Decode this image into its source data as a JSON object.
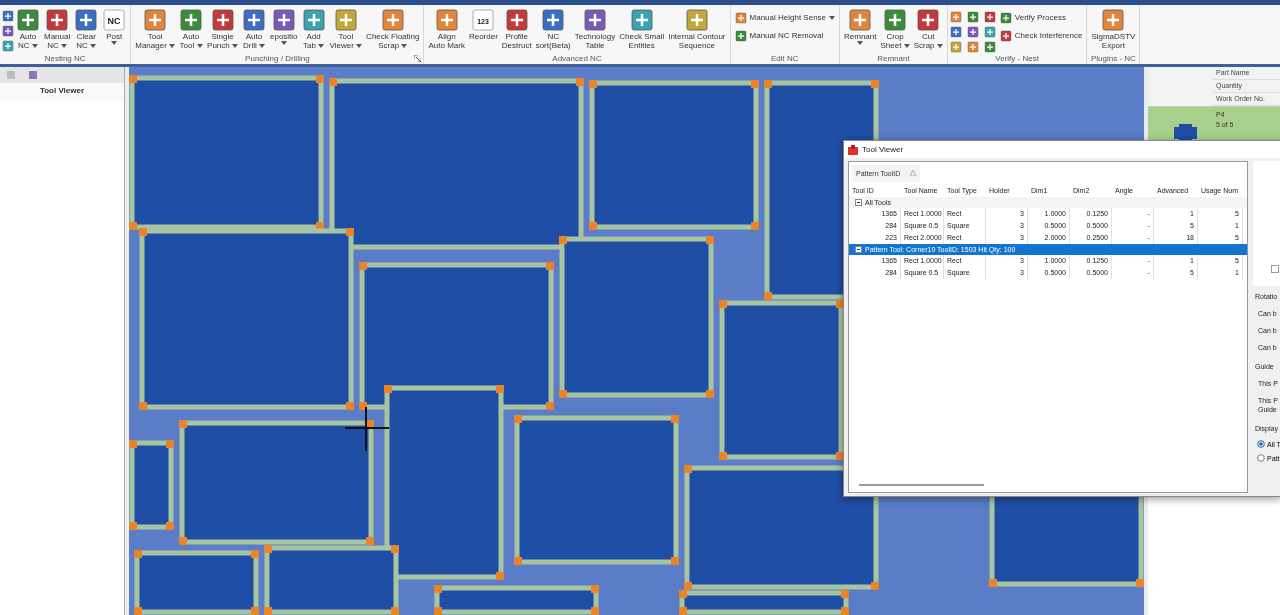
{
  "ribbon": {
    "groups": [
      {
        "label": "Nesting NC",
        "buttons": [
          {
            "kind": "icon-stack"
          },
          {
            "kind": "large",
            "lines": [
              "Auto",
              "NC"
            ],
            "dropdown": true
          },
          {
            "kind": "large",
            "lines": [
              "Manual",
              "NC"
            ],
            "dropdown": true
          },
          {
            "kind": "large",
            "lines": [
              "Clear",
              "NC"
            ],
            "dropdown": true
          },
          {
            "kind": "large",
            "lines": [
              "Post"
            ],
            "dropdown": true,
            "icon_text": "NC"
          }
        ]
      },
      {
        "label": "Punching / Drilling",
        "launcher": true,
        "buttons": [
          {
            "kind": "large",
            "lines": [
              "Tool",
              "Manager"
            ],
            "dropdown": true
          },
          {
            "kind": "large",
            "lines": [
              "Auto",
              "Tool"
            ],
            "dropdown": true
          },
          {
            "kind": "large",
            "lines": [
              "Single",
              "Punch"
            ],
            "dropdown": true
          },
          {
            "kind": "large",
            "lines": [
              "Auto",
              "Drill"
            ],
            "dropdown": true
          },
          {
            "kind": "large",
            "lines": [
              "epositio"
            ],
            "dropdown": true
          },
          {
            "kind": "large",
            "lines": [
              "Add",
              "Tab"
            ],
            "dropdown": true
          },
          {
            "kind": "large",
            "lines": [
              "Tool",
              "Viewer"
            ],
            "dropdown": true
          },
          {
            "kind": "large",
            "lines": [
              "Check Floating",
              "Scrap"
            ],
            "dropdown": true
          }
        ]
      },
      {
        "label": "Advanced NC",
        "buttons": [
          {
            "kind": "large",
            "lines": [
              "Align",
              "Auto Mark"
            ],
            "dropdown": false
          },
          {
            "kind": "large",
            "lines": [
              "Reorder"
            ],
            "dropdown": false,
            "icon_text": "123"
          },
          {
            "kind": "large",
            "lines": [
              "Profile",
              "Destruct"
            ],
            "dropdown": false
          },
          {
            "kind": "large",
            "lines": [
              "NC",
              "sort(Beta)"
            ],
            "dropdown": false
          },
          {
            "kind": "large",
            "lines": [
              "Technology",
              "Table"
            ],
            "dropdown": false
          },
          {
            "kind": "large",
            "lines": [
              "Check Small",
              "Entities"
            ],
            "dropdown": false
          },
          {
            "kind": "large",
            "lines": [
              "Internal Contour",
              "Sequence"
            ],
            "dropdown": false
          }
        ]
      },
      {
        "label": "Edit NC",
        "buttons": [
          {
            "kind": "small",
            "lines": [
              "Manual Height Sense"
            ],
            "dropdown": true
          },
          {
            "kind": "small",
            "lines": [
              "Manual NC Removal"
            ],
            "dropdown": false
          }
        ]
      },
      {
        "label": "Remnant",
        "buttons": [
          {
            "kind": "large",
            "lines": [
              "Remnant"
            ],
            "dropdown": true
          },
          {
            "kind": "large",
            "lines": [
              "Crop",
              "Sheet"
            ],
            "dropdown": true
          },
          {
            "kind": "large",
            "lines": [
              "Cut",
              "Scrap"
            ],
            "dropdown": true
          }
        ]
      },
      {
        "label": "Verify - Nest",
        "buttons": [
          {
            "kind": "icon-grid"
          },
          {
            "kind": "small",
            "lines": [
              "Verify Process"
            ],
            "dropdown": false
          },
          {
            "kind": "small",
            "lines": [
              "Check Interference"
            ],
            "dropdown": false
          }
        ]
      },
      {
        "label": "Plugins - NC",
        "buttons": [
          {
            "kind": "large",
            "lines": [
              "SigmaDSTV",
              "Export"
            ],
            "dropdown": false
          }
        ]
      }
    ]
  },
  "left_panel": {
    "title": "Tool Viewer"
  },
  "parts_panel": {
    "fields": [
      "Part Name",
      "Quantity",
      "Work Order No."
    ],
    "parts": [
      {
        "name": "P4",
        "quantity": "5 of 5",
        "selected": true
      }
    ]
  },
  "tool_viewer": {
    "title": "Tool Viewer",
    "group_by": "Pattern ToolID",
    "columns": [
      "Tool ID",
      "Tool Name",
      "Tool Type",
      "Holder",
      "Dim1",
      "Dim2",
      "Angle",
      "Advanced",
      "Usage Num"
    ],
    "groups": [
      {
        "label": "All Tools",
        "expanded": true,
        "selected": false,
        "rows": [
          [
            "1365",
            "Rect 1.0000",
            "Rect",
            "3",
            "1.0000",
            "0.1250",
            "-",
            "1",
            "5"
          ],
          [
            "284",
            "Square 0.5",
            "Square",
            "3",
            "0.5000",
            "0.5000",
            "-",
            "5",
            "1"
          ],
          [
            "223",
            "Rect 2.0000",
            "Rect",
            "3",
            "2.0000",
            "0.2500",
            "-",
            "18",
            "5"
          ]
        ]
      },
      {
        "label": "Pattern Tool: Corner10 ToolID: 1503 Hit Qty: 100",
        "expanded": true,
        "selected": true,
        "rows": [
          [
            "1365",
            "Rect 1.0000",
            "Rect",
            "3",
            "1.0000",
            "0.1250",
            "-",
            "1",
            "5"
          ],
          [
            "284",
            "Square 0.5",
            "Square",
            "3",
            "0.5000",
            "0.5000",
            "-",
            "5",
            "1"
          ]
        ]
      }
    ],
    "preview_checkbox": {
      "checked": false
    },
    "options": [
      {
        "kind": "heading",
        "text": "Rotatio"
      },
      {
        "kind": "item",
        "text": "Can b"
      },
      {
        "kind": "item",
        "text": "Can b"
      },
      {
        "kind": "item",
        "text": "Can b"
      },
      {
        "kind": "heading",
        "text": "Guide"
      },
      {
        "kind": "item",
        "text": "This P"
      },
      {
        "kind": "item",
        "text": "This P Guide"
      }
    ],
    "display": {
      "label": "Display",
      "choices": [
        {
          "label": "All T",
          "selected": true
        },
        {
          "label": "Patt",
          "selected": false
        }
      ]
    }
  }
}
